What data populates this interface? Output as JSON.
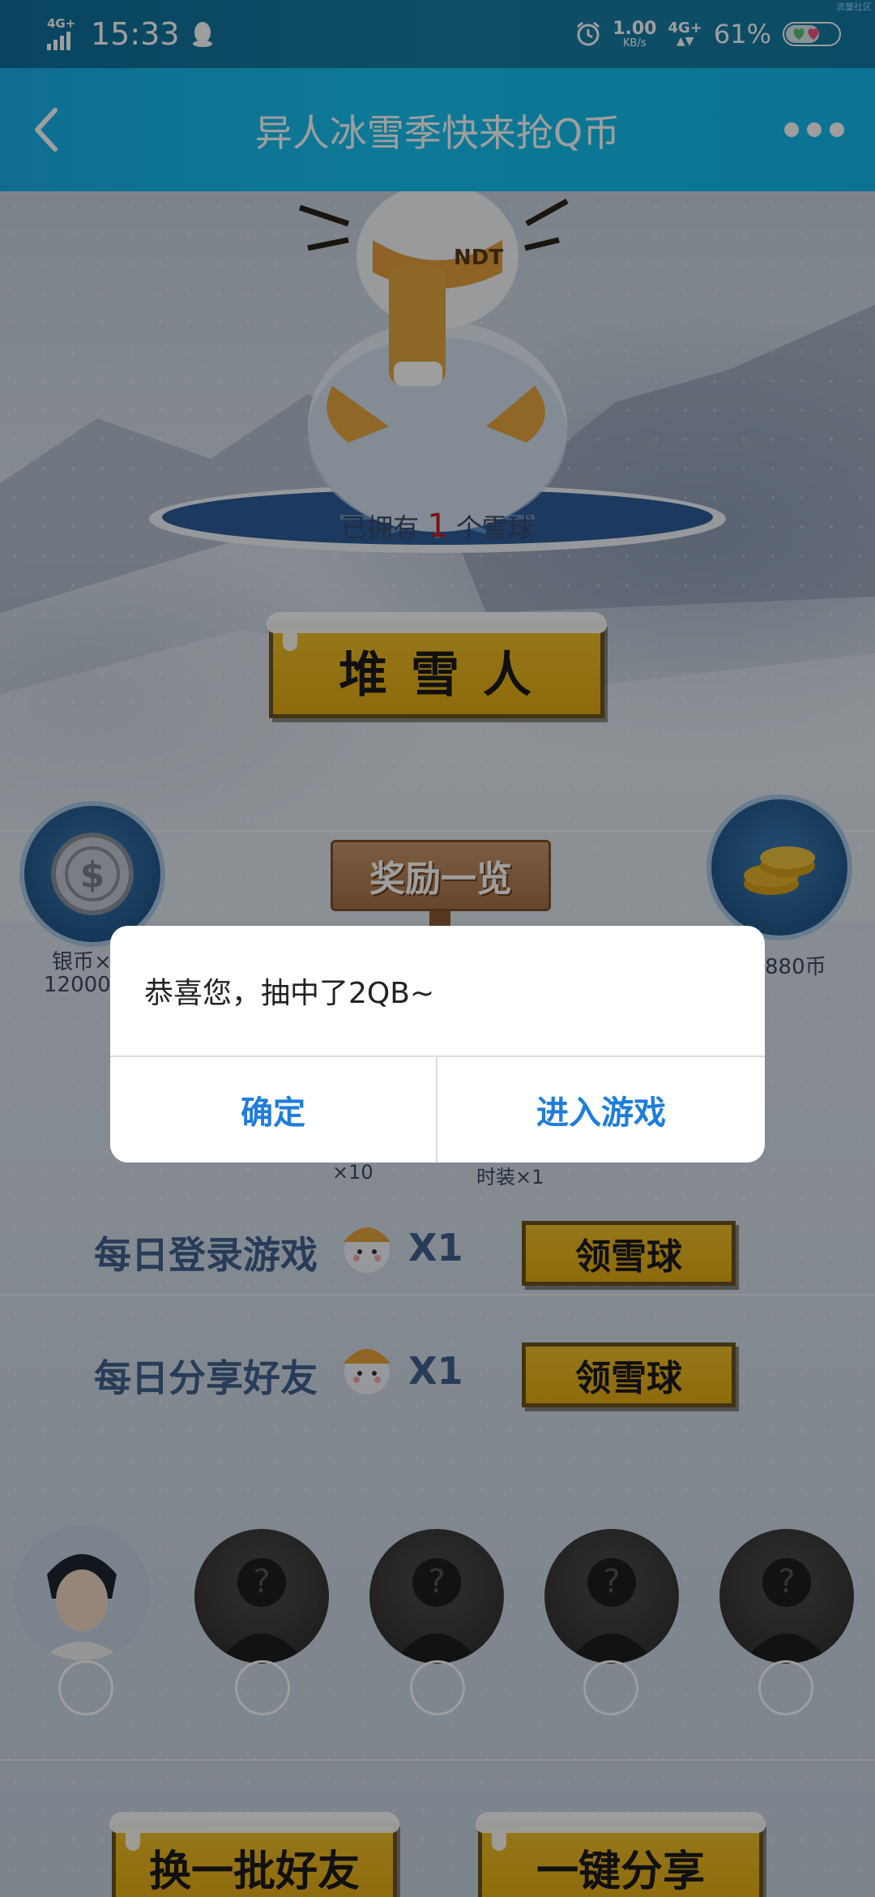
{
  "status_bar": {
    "network_left": "4G+",
    "time": "15:33",
    "speed_value": "1.00",
    "speed_unit": "KB/s",
    "network_right": "4G+",
    "battery_percent": "61%",
    "corner_note": "流量社区"
  },
  "title_bar": {
    "title": "异人冰雪季快来抢Q币"
  },
  "main": {
    "build_button": "堆 雪 人",
    "snowball_prefix": "已拥有",
    "snowball_count": "1",
    "snowball_suffix": "个雪球",
    "reward_sign": "奖励一览",
    "prize_left_label_1": "银币×",
    "prize_left_label_2": "12000",
    "prize_right_label": "880币",
    "mid_label_left": "×10",
    "mid_label_right": "时装×1",
    "tasks": [
      {
        "label": "每日登录游戏",
        "multiplier": "X1",
        "button": "领雪球"
      },
      {
        "label": "每日分享好友",
        "multiplier": "X1",
        "button": "领雪球"
      }
    ],
    "bottom_buttons": {
      "refresh_friends": "换一批好友",
      "share_all": "一键分享"
    }
  },
  "dialog": {
    "message": "恭喜您，抽中了2QB~",
    "confirm": "确定",
    "enter_game": "进入游戏"
  },
  "colors": {
    "title_bar": "#15c4f2",
    "status_bar": "#137aa3",
    "button_yellow": "#eab61d",
    "dialog_button_text": "#1f7dd9",
    "count_red": "#c61c1c"
  }
}
